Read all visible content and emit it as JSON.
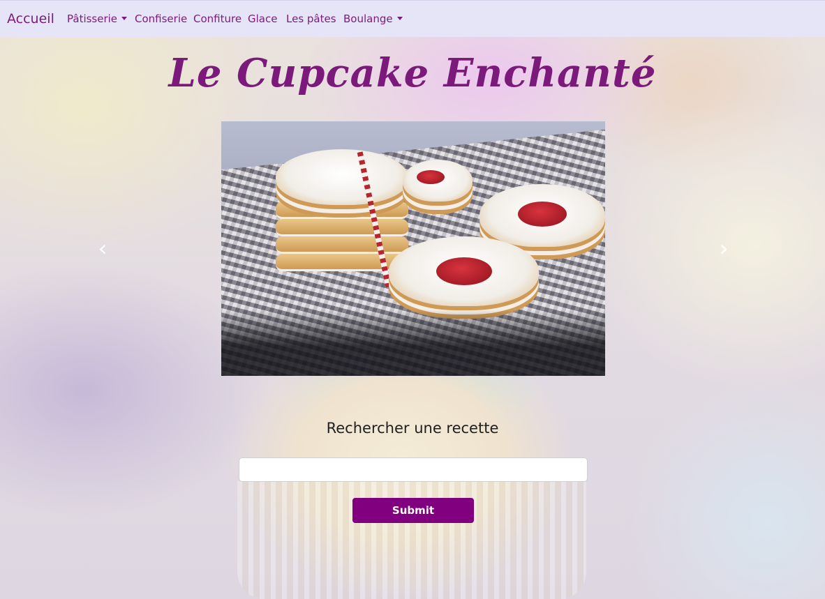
{
  "navbar": {
    "brand": "Accueil",
    "items": [
      {
        "label": "Pâtisserie",
        "dropdown": true
      },
      {
        "label": "Confiserie",
        "dropdown": false
      },
      {
        "label": "Confiture",
        "dropdown": false
      },
      {
        "label": "Glace",
        "dropdown": false
      },
      {
        "label": "Les pâtes",
        "dropdown": false
      },
      {
        "label": "Boulange",
        "dropdown": true
      }
    ]
  },
  "header": {
    "title": "Le Cupcake Enchanté"
  },
  "carousel": {
    "prev_icon": "chevron-left-icon",
    "next_icon": "chevron-right-icon",
    "prev_glyph": "‹",
    "next_glyph": "›"
  },
  "search": {
    "label": "Rechercher une recette",
    "value": "",
    "placeholder": "",
    "submit_label": "Submit"
  },
  "colors": {
    "accent": "#800080",
    "nav_text": "#7c1a7c",
    "navbar_bg": "#e6e4f7"
  }
}
